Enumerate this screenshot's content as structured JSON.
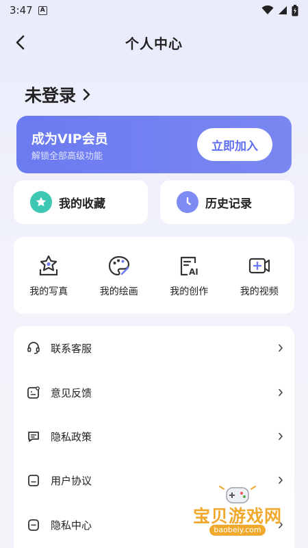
{
  "status": {
    "time": "3:47",
    "notif_letter": "A"
  },
  "nav": {
    "title": "个人中心"
  },
  "login": {
    "label": "未登录"
  },
  "vip": {
    "title": "成为VIP会员",
    "subtitle": "解锁全部高级功能",
    "button": "立即加入"
  },
  "quick": {
    "favorites": "我的收藏",
    "history": "历史记录"
  },
  "grid": [
    {
      "label": "我的写真",
      "icon": "portrait-icon"
    },
    {
      "label": "我的绘画",
      "icon": "palette-icon"
    },
    {
      "label": "我的创作",
      "icon": "ai-creation-icon"
    },
    {
      "label": "我的视频",
      "icon": "video-add-icon"
    }
  ],
  "list": [
    {
      "label": "联系客服",
      "icon": "headset-icon"
    },
    {
      "label": "意见反馈",
      "icon": "feedback-icon"
    },
    {
      "label": "隐私政策",
      "icon": "privacy-policy-icon"
    },
    {
      "label": "用户协议",
      "icon": "user-agreement-icon"
    },
    {
      "label": "隐私中心",
      "icon": "privacy-center-icon"
    }
  ],
  "watermark": {
    "text": "宝贝游戏网",
    "url": "baobeiy.com"
  },
  "colors": {
    "accent": "#6b7bf0",
    "star_bg": "#3ec7b3",
    "clock_bg": "#7d8cf2"
  }
}
